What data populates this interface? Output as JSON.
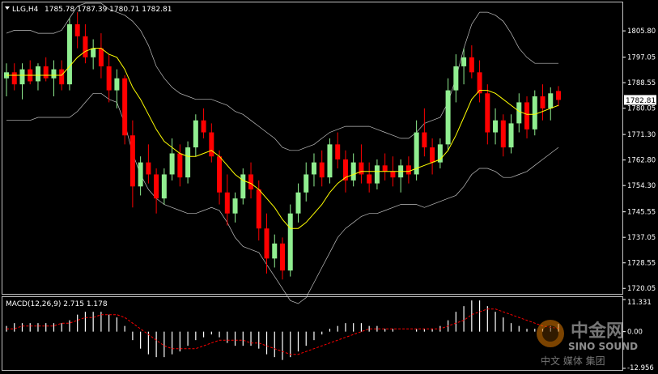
{
  "header": {
    "symbol_label": "LLG,H4",
    "ohlc": "1785.78 1787.39 1780.71 1782.81"
  },
  "colors": {
    "background": "#000000",
    "bull_candle": "#90EE90",
    "bear_candle": "#FF0000",
    "moving_average": "#FFFF00",
    "bollinger": "#C0C0C0",
    "macd_histogram": "#FFFFFF",
    "macd_signal": "#FF0000",
    "price_badge": "#FFFFFF",
    "axis_text": "#FFFFFF"
  },
  "watermark": {
    "logo_cn": "中金网",
    "logo_en": "SINO SOUND",
    "slogan": "中文 媒体 集团"
  },
  "chart_data": [
    {
      "type": "candlestick",
      "title": "LLG,H4",
      "current_price": "1782.81",
      "ylim": [
        1718.5,
        1815.0
      ],
      "y_ticks": [
        "1805.80",
        "1797.05",
        "1788.55",
        "1780.05",
        "1771.30",
        "1762.80",
        "1754.30",
        "1745.55",
        "1737.05",
        "1728.55",
        "1720.05"
      ],
      "grid": false,
      "overlays": [
        "moving-average",
        "bollinger-bands"
      ],
      "candles_ohlc": [
        [
          1790,
          1795,
          1784,
          1792
        ],
        [
          1792,
          1795,
          1786,
          1788
        ],
        [
          1788,
          1795,
          1783,
          1793
        ],
        [
          1793,
          1796,
          1788,
          1789
        ],
        [
          1789,
          1795,
          1786,
          1794
        ],
        [
          1794,
          1797,
          1789,
          1790
        ],
        [
          1790,
          1796,
          1784,
          1793
        ],
        [
          1793,
          1796,
          1786,
          1788
        ],
        [
          1788,
          1810,
          1786,
          1808
        ],
        [
          1808,
          1812,
          1800,
          1804
        ],
        [
          1804,
          1808,
          1795,
          1797
        ],
        [
          1797,
          1803,
          1793,
          1800
        ],
        [
          1800,
          1805,
          1790,
          1794
        ],
        [
          1794,
          1798,
          1782,
          1786
        ],
        [
          1786,
          1793,
          1780,
          1790
        ],
        [
          1790,
          1791,
          1768,
          1771
        ],
        [
          1771,
          1776,
          1747,
          1754
        ],
        [
          1754,
          1764,
          1751,
          1762
        ],
        [
          1762,
          1768,
          1755,
          1758
        ],
        [
          1758,
          1760,
          1745,
          1750
        ],
        [
          1750,
          1760,
          1748,
          1758
        ],
        [
          1758,
          1770,
          1756,
          1765
        ],
        [
          1765,
          1768,
          1754,
          1757
        ],
        [
          1757,
          1769,
          1755,
          1767
        ],
        [
          1767,
          1778,
          1764,
          1776
        ],
        [
          1776,
          1780,
          1770,
          1772
        ],
        [
          1772,
          1775,
          1762,
          1764
        ],
        [
          1764,
          1766,
          1748,
          1752
        ],
        [
          1752,
          1758,
          1741,
          1745
        ],
        [
          1745,
          1752,
          1742,
          1750
        ],
        [
          1750,
          1760,
          1748,
          1758
        ],
        [
          1758,
          1762,
          1750,
          1753
        ],
        [
          1753,
          1756,
          1736,
          1740
        ],
        [
          1740,
          1745,
          1725,
          1730
        ],
        [
          1730,
          1738,
          1727,
          1735
        ],
        [
          1735,
          1737,
          1723,
          1726
        ],
        [
          1726,
          1748,
          1724,
          1745
        ],
        [
          1745,
          1755,
          1742,
          1752
        ],
        [
          1752,
          1762,
          1749,
          1758
        ],
        [
          1758,
          1765,
          1754,
          1762
        ],
        [
          1762,
          1766,
          1754,
          1757
        ],
        [
          1757,
          1770,
          1755,
          1768
        ],
        [
          1768,
          1772,
          1760,
          1763
        ],
        [
          1763,
          1766,
          1752,
          1756
        ],
        [
          1756,
          1765,
          1754,
          1762
        ],
        [
          1762,
          1768,
          1755,
          1758
        ],
        [
          1758,
          1762,
          1752,
          1755
        ],
        [
          1755,
          1763,
          1753,
          1761
        ],
        [
          1761,
          1765,
          1756,
          1759
        ],
        [
          1759,
          1764,
          1754,
          1757
        ],
        [
          1757,
          1763,
          1752,
          1761
        ],
        [
          1761,
          1764,
          1755,
          1758
        ],
        [
          1758,
          1776,
          1756,
          1772
        ],
        [
          1772,
          1780,
          1764,
          1767
        ],
        [
          1767,
          1770,
          1758,
          1762
        ],
        [
          1762,
          1770,
          1760,
          1768
        ],
        [
          1768,
          1790,
          1766,
          1786
        ],
        [
          1786,
          1798,
          1782,
          1794
        ],
        [
          1794,
          1800,
          1788,
          1797
        ],
        [
          1797,
          1801,
          1790,
          1792
        ],
        [
          1792,
          1796,
          1782,
          1785
        ],
        [
          1785,
          1788,
          1768,
          1772
        ],
        [
          1772,
          1780,
          1768,
          1776
        ],
        [
          1776,
          1778,
          1764,
          1767
        ],
        [
          1767,
          1778,
          1765,
          1775
        ],
        [
          1775,
          1785,
          1772,
          1782
        ],
        [
          1782,
          1784,
          1770,
          1773
        ],
        [
          1773,
          1786,
          1771,
          1784
        ],
        [
          1784,
          1788,
          1776,
          1780
        ],
        [
          1780,
          1787,
          1776,
          1785
        ],
        [
          1785.78,
          1787.39,
          1780.71,
          1782.81
        ]
      ],
      "ma_values": [
        1791,
        1791,
        1791,
        1791,
        1791,
        1791,
        1791,
        1791,
        1794,
        1797,
        1799,
        1800,
        1800,
        1798,
        1797,
        1793,
        1787,
        1783,
        1778,
        1773,
        1769,
        1767,
        1765,
        1764,
        1764,
        1765,
        1766,
        1764,
        1761,
        1758,
        1756,
        1755,
        1753,
        1750,
        1747,
        1743,
        1740,
        1740,
        1742,
        1745,
        1748,
        1752,
        1755,
        1757,
        1758,
        1759,
        1759,
        1759,
        1759,
        1759,
        1759,
        1759,
        1760,
        1761,
        1762,
        1763,
        1766,
        1771,
        1777,
        1783,
        1786,
        1786,
        1785,
        1783,
        1781,
        1779,
        1778,
        1778,
        1779,
        1780,
        1781
      ],
      "bb_upper_values": [
        1805,
        1806,
        1806,
        1806,
        1805,
        1805,
        1805,
        1806,
        1810,
        1814,
        1815,
        1815,
        1815,
        1813,
        1812,
        1811,
        1809,
        1806,
        1801,
        1794,
        1790,
        1787,
        1785,
        1784,
        1783,
        1783,
        1783,
        1782,
        1781,
        1779,
        1778,
        1776,
        1774,
        1772,
        1770,
        1767,
        1766,
        1766,
        1767,
        1768,
        1770,
        1772,
        1773,
        1774,
        1774,
        1774,
        1774,
        1773,
        1772,
        1771,
        1770,
        1770,
        1772,
        1775,
        1776,
        1777,
        1782,
        1790,
        1800,
        1808,
        1812,
        1812,
        1811,
        1809,
        1805,
        1800,
        1797,
        1795,
        1795,
        1795,
        1795
      ],
      "bb_lower_values": [
        1776,
        1776,
        1776,
        1776,
        1777,
        1777,
        1777,
        1777,
        1777,
        1779,
        1782,
        1785,
        1785,
        1783,
        1782,
        1775,
        1765,
        1758,
        1753,
        1750,
        1748,
        1747,
        1746,
        1745,
        1745,
        1746,
        1747,
        1746,
        1742,
        1737,
        1734,
        1733,
        1732,
        1728,
        1724,
        1720,
        1716,
        1715,
        1717,
        1722,
        1727,
        1732,
        1737,
        1740,
        1742,
        1744,
        1745,
        1745,
        1746,
        1747,
        1748,
        1748,
        1748,
        1747,
        1748,
        1749,
        1750,
        1751,
        1754,
        1758,
        1760,
        1760,
        1759,
        1757,
        1757,
        1758,
        1759,
        1761,
        1763,
        1765,
        1767
      ]
    },
    {
      "type": "macd",
      "title": "MACD(12,26,9) 2.715 1.178",
      "ylim": [
        -12.956,
        11.331
      ],
      "y_ticks": [
        "11.331",
        "0.00",
        "-12.956"
      ],
      "histogram_values": [
        2,
        3,
        3,
        3,
        3,
        3,
        3,
        3,
        4,
        6,
        7,
        7,
        7,
        6,
        5,
        2,
        -3,
        -6,
        -8,
        -9,
        -9,
        -8,
        -7,
        -5,
        -3,
        -2,
        -1,
        -2,
        -4,
        -5,
        -5,
        -5,
        -6,
        -8,
        -9,
        -10,
        -9,
        -7,
        -5,
        -3,
        -1,
        1,
        2,
        3,
        3,
        3,
        2,
        2,
        1,
        1,
        0,
        0,
        1,
        1,
        1,
        2,
        4,
        7,
        9,
        11,
        11,
        9,
        7,
        5,
        3,
        2,
        1,
        1,
        1,
        2,
        2.715
      ],
      "signal_values": [
        1,
        1,
        2,
        2,
        2,
        2,
        2,
        3,
        3,
        4,
        5,
        5,
        6,
        6,
        6,
        5,
        3,
        1,
        -1,
        -3,
        -5,
        -6,
        -6,
        -6,
        -6,
        -5,
        -4,
        -3,
        -3,
        -3,
        -3,
        -4,
        -4,
        -5,
        -6,
        -7,
        -8,
        -8,
        -7,
        -6,
        -5,
        -4,
        -3,
        -2,
        -1,
        0,
        1,
        1,
        1,
        1,
        1,
        1,
        1,
        1,
        1,
        1,
        2,
        3,
        4,
        6,
        7,
        8,
        8,
        7,
        6,
        5,
        4,
        3,
        2,
        1.5,
        1.178
      ]
    }
  ]
}
